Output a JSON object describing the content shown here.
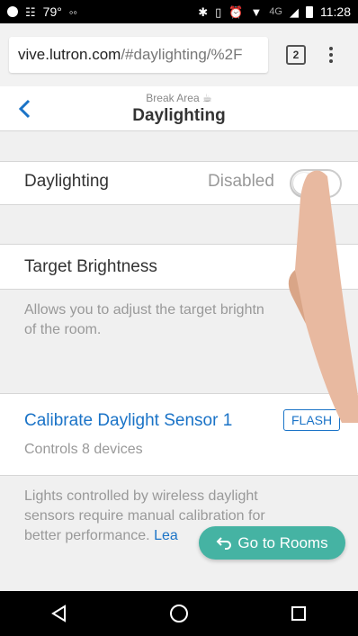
{
  "status_bar": {
    "temperature": "79°",
    "time": "11:28",
    "network": "4G"
  },
  "browser": {
    "url_domain": "vive.lutron.com",
    "url_path": "/#daylighting/%2F",
    "tab_count": "2"
  },
  "header": {
    "subtitle": "Break Area ☕",
    "title": "Daylighting"
  },
  "daylighting_row": {
    "label": "Daylighting",
    "status": "Disabled",
    "toggle_on": false
  },
  "target_brightness": {
    "label": "Target Brightness",
    "description_line1": "Allows you to adjust the target brightn",
    "description_line2": "of the room."
  },
  "calibrate": {
    "label": "Calibrate Daylight Sensor 1",
    "flash_label": "FLASH",
    "sub": "Controls 8 devices"
  },
  "footer_note": {
    "line1": "Lights controlled by wireless daylight",
    "line2": "sensors require manual calibration for",
    "line3_prefix": "better performance. ",
    "line3_link": "Lea"
  },
  "goto_rooms": {
    "label": "Go to Rooms"
  },
  "colors": {
    "accent_blue": "#1a73c7",
    "teal": "#45b3a3"
  }
}
